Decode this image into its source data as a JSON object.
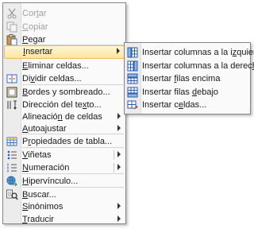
{
  "context_menu": {
    "items": [
      {
        "label": "Cortar",
        "key": "t",
        "pre": "Cor",
        "post": "ar",
        "icon": "scissors-icon",
        "disabled": true
      },
      {
        "label": "Copiar",
        "key": "C",
        "pre": "",
        "post": "opiar",
        "icon": "copy-icon",
        "disabled": true
      },
      {
        "label": "Pegar",
        "key": "P",
        "pre": "",
        "post": "egar",
        "icon": "paste-icon",
        "disabled": false
      },
      {
        "label": "Insertar",
        "key": "I",
        "pre": "",
        "post": "nsertar",
        "icon": "",
        "has_submenu": true,
        "active": true
      },
      {
        "label": "Eliminar celdas...",
        "key": "E",
        "pre": "",
        "post": "liminar celdas...",
        "icon": ""
      },
      {
        "label": "Dividir celdas...",
        "key": "v",
        "pre": "Di",
        "post": "idir celdas...",
        "icon": "split-cells-icon"
      },
      {
        "label": "Bordes y sombreado...",
        "key": "B",
        "pre": "",
        "post": "ordes y sombreado...",
        "icon": "borders-shading-icon"
      },
      {
        "label": "Dirección del texto...",
        "key": "x",
        "pre": "Dirección del te",
        "post": "to...",
        "icon": "text-direction-icon"
      },
      {
        "label": "Alineación de celdas",
        "key": "n",
        "pre": "Alineació",
        "post": " de celdas",
        "icon": "",
        "has_submenu": true
      },
      {
        "label": "Autoajustar",
        "key": "A",
        "pre": "",
        "post": "utoajustar",
        "icon": "",
        "has_submenu": true
      },
      {
        "label": "Propiedades de tabla...",
        "key": "r",
        "pre": "P",
        "post": "opiedades de tabla...",
        "icon": "table-properties-icon"
      },
      {
        "label": "Viñetas",
        "key": "V",
        "pre": "",
        "post": "iñetas",
        "icon": "bullets-icon",
        "has_submenu": true,
        "split": true
      },
      {
        "label": "Numeración",
        "key": "N",
        "pre": "",
        "post": "umeración",
        "icon": "numbering-icon",
        "has_submenu": true,
        "split": true
      },
      {
        "label": "Hipervínculo...",
        "key": "H",
        "pre": "",
        "post": "ipervínculo...",
        "icon": "hyperlink-icon"
      },
      {
        "label": "Buscar...",
        "key": "B",
        "pre": "",
        "post": "uscar...",
        "icon": "research-icon"
      },
      {
        "label": "Sinónimos",
        "key": "S",
        "pre": "",
        "post": "inónimos",
        "icon": "",
        "has_submenu": true
      },
      {
        "label": "Traducir",
        "key": "T",
        "pre": "",
        "post": "raducir",
        "icon": "",
        "has_submenu": true
      }
    ]
  },
  "insert_submenu": {
    "items": [
      {
        "label": "Insertar columnas a la izquierda",
        "key": "z",
        "pre": "Insertar columnas a la i",
        "post": "quierda",
        "icon": "insert-columns-left-icon"
      },
      {
        "label": "Insertar columnas a la derecha",
        "key": "h",
        "pre": "Insertar columnas a la derec",
        "post": "a",
        "icon": "insert-columns-right-icon"
      },
      {
        "label": "Insertar filas encima",
        "key": "f",
        "pre": "Insertar ",
        "post": "ilas encima",
        "icon": "insert-rows-above-icon"
      },
      {
        "label": "Insertar filas debajo",
        "key": "d",
        "pre": "Insertar filas ",
        "post": "ebajo",
        "icon": "insert-rows-below-icon"
      },
      {
        "label": "Insertar celdas...",
        "key": "e",
        "pre": "Insertar c",
        "post": "ldas...",
        "icon": "insert-cells-icon"
      }
    ]
  }
}
